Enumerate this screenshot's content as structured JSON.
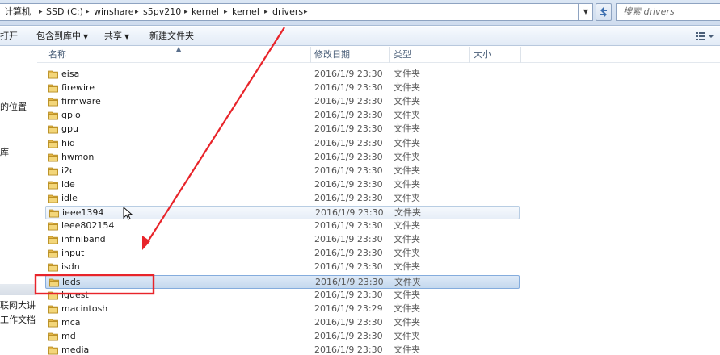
{
  "address_bar": {
    "crumbs": [
      "计算机",
      "SSD (C:)",
      "winshare",
      "s5pv210",
      "kernel",
      "kernel",
      "drivers"
    ],
    "search_placeholder": "搜索 drivers"
  },
  "toolbar": {
    "open_label": "打开",
    "include_library_label": "包含到库中",
    "share_label": "共享",
    "new_folder_label": "新建文件夹"
  },
  "nav_pane": {
    "items": [
      {
        "label": "的位置"
      },
      {
        "label": "库"
      },
      {
        "label": "联网大讲堂"
      },
      {
        "label": "工作文档 (I"
      }
    ]
  },
  "columns": {
    "name": "名称",
    "date": "修改日期",
    "type": "类型",
    "size": "大小"
  },
  "files": [
    {
      "name": "eisa",
      "date": "2016/1/9 23:30",
      "type": "文件夹",
      "state": "normal"
    },
    {
      "name": "firewire",
      "date": "2016/1/9 23:30",
      "type": "文件夹",
      "state": "normal"
    },
    {
      "name": "firmware",
      "date": "2016/1/9 23:30",
      "type": "文件夹",
      "state": "normal"
    },
    {
      "name": "gpio",
      "date": "2016/1/9 23:30",
      "type": "文件夹",
      "state": "normal"
    },
    {
      "name": "gpu",
      "date": "2016/1/9 23:30",
      "type": "文件夹",
      "state": "normal"
    },
    {
      "name": "hid",
      "date": "2016/1/9 23:30",
      "type": "文件夹",
      "state": "normal"
    },
    {
      "name": "hwmon",
      "date": "2016/1/9 23:30",
      "type": "文件夹",
      "state": "normal"
    },
    {
      "name": "i2c",
      "date": "2016/1/9 23:30",
      "type": "文件夹",
      "state": "normal"
    },
    {
      "name": "ide",
      "date": "2016/1/9 23:30",
      "type": "文件夹",
      "state": "normal"
    },
    {
      "name": "idle",
      "date": "2016/1/9 23:30",
      "type": "文件夹",
      "state": "normal"
    },
    {
      "name": "ieee1394",
      "date": "2016/1/9 23:30",
      "type": "文件夹",
      "state": "hover"
    },
    {
      "name": "ieee802154",
      "date": "2016/1/9 23:30",
      "type": "文件夹",
      "state": "normal"
    },
    {
      "name": "infiniband",
      "date": "2016/1/9 23:30",
      "type": "文件夹",
      "state": "normal"
    },
    {
      "name": "input",
      "date": "2016/1/9 23:30",
      "type": "文件夹",
      "state": "normal"
    },
    {
      "name": "isdn",
      "date": "2016/1/9 23:30",
      "type": "文件夹",
      "state": "normal"
    },
    {
      "name": "leds",
      "date": "2016/1/9 23:30",
      "type": "文件夹",
      "state": "selected"
    },
    {
      "name": "lguest",
      "date": "2016/1/9 23:30",
      "type": "文件夹",
      "state": "normal"
    },
    {
      "name": "macintosh",
      "date": "2016/1/9 23:29",
      "type": "文件夹",
      "state": "normal"
    },
    {
      "name": "mca",
      "date": "2016/1/9 23:30",
      "type": "文件夹",
      "state": "normal"
    },
    {
      "name": "md",
      "date": "2016/1/9 23:30",
      "type": "文件夹",
      "state": "normal"
    },
    {
      "name": "media",
      "date": "2016/1/9 23:30",
      "type": "文件夹",
      "state": "normal"
    }
  ],
  "colors": {
    "annotation": "#e8242a",
    "selection": "#c4d8ee",
    "folder": "#e8bf4d"
  },
  "icons": {
    "folder": "folder-icon",
    "view": "view-options-icon",
    "refresh": "refresh-icon",
    "cursor": "mouse-cursor-icon"
  }
}
